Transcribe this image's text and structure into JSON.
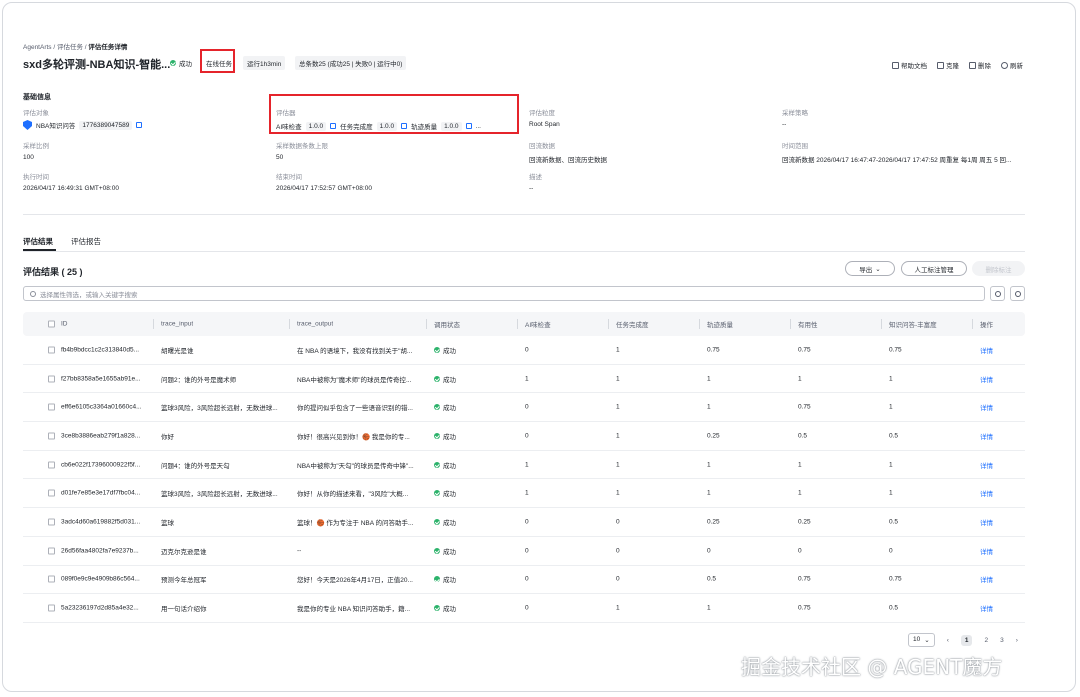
{
  "breadcrumb": {
    "root": "AgentArts",
    "sep1": "/",
    "mid": "评估任务",
    "sep2": "/",
    "current": "评估任务详情"
  },
  "header": {
    "title": "sxd多轮评测-NBA知识-智能...",
    "status": "成功",
    "task_type": "在线任务",
    "runtime": "运行1h3min",
    "summary": "总条数25 (成功25 | 失败0 | 运行中0)",
    "actions": {
      "help": "帮助文档",
      "clone": "克隆",
      "delete": "删除",
      "refresh": "刷新"
    }
  },
  "basic": {
    "section_title": "基础信息",
    "eval_target_label": "评估对象",
    "eval_target_name": "NBA知识问答",
    "eval_target_id": "1776389047589",
    "evaluator_label": "评估器",
    "evaluators": [
      {
        "name": "AI味检查",
        "version": "1.0.0"
      },
      {
        "name": "任务完成度",
        "version": "1.0.0"
      },
      {
        "name": "轨迹质量",
        "version": "1.0.0"
      }
    ],
    "evaluator_more": "...",
    "granularity_label": "评估粒度",
    "granularity": "Root Span",
    "sampling_strategy_label": "采样策略",
    "sampling_strategy": "--",
    "sampling_ratio_label": "采样比例",
    "sampling_ratio": "100",
    "sampling_limit_label": "采样数据条数上限",
    "sampling_limit": "50",
    "backflow_label": "回流数据",
    "backflow": "回流新数据、回流历史数据",
    "time_range_label": "时间范围",
    "time_range": "回流新数据 2026/04/17 16:47:47-2026/04/17 17:47:52 周重复 每1周 周五 5 回...",
    "exec_time_label": "执行时间",
    "exec_time": "2026/04/17 16:49:31 GMT+08:00",
    "end_time_label": "结束时间",
    "end_time": "2026/04/17 17:52:57 GMT+08:00",
    "desc_label": "描述",
    "desc": "--"
  },
  "tabs": {
    "results": "评估结果",
    "report": "评估报告"
  },
  "results": {
    "title": "评估结果 ( 25 )",
    "export": "导出",
    "manual": "人工标注管理",
    "disabled_btn": "删除标注",
    "search_placeholder": "选择属性筛选，或输入关键字搜索"
  },
  "table": {
    "headers": [
      "ID",
      "trace_input",
      "trace_output",
      "调用状态",
      "AI味检查",
      "任务完成度",
      "轨迹质量",
      "有用性",
      "知识问答-丰富度",
      "操作"
    ],
    "rows": [
      [
        "fb4b9bdcc1c2c313840d5...",
        "胡曙光是谁",
        "在 NBA 的语境下，我没有找到关于\"胡...",
        "成功",
        "0",
        "1",
        "0.75",
        "0.75",
        "0.75",
        "详情"
      ],
      [
        "f27bb8358a5e1655ab91e...",
        "问题2：谁的外号是魔术师",
        "NBA中被称为\"魔术师\"的球员是传奇控...",
        "成功",
        "1",
        "1",
        "1",
        "1",
        "1",
        "详情"
      ],
      [
        "eff6e6105c3364a01660c4...",
        "篮球3风险，3风险超长远射，无数进球...",
        "你的提问似乎包含了一些语音识别的错...",
        "成功",
        "0",
        "1",
        "1",
        "0.75",
        "1",
        "详情"
      ],
      [
        "3ce8b3886eab279f1a828...",
        "你好",
        "你好！很高兴见到你！🏀 我是你的专...",
        "成功",
        "0",
        "1",
        "0.25",
        "0.5",
        "0.5",
        "详情"
      ],
      [
        "cb6e022f17396000922f5f...",
        "问题4：谁的外号是天勾",
        "NBA中被称为\"天勾\"的球员是传奇中锋\"...",
        "成功",
        "1",
        "1",
        "1",
        "1",
        "1",
        "详情"
      ],
      [
        "d01fe7e85e3e17df7fbc04...",
        "篮球3风险，3风险超长远射，无数进球...",
        "你好！从你的描述来看，\"3风险\"大概...",
        "成功",
        "1",
        "1",
        "1",
        "1",
        "1",
        "详情"
      ],
      [
        "3adc4d60a619882f5d031...",
        "篮球",
        "篮球！🏀 作为专注于 NBA 的问答助手...",
        "成功",
        "0",
        "0",
        "0.25",
        "0.25",
        "0.5",
        "详情"
      ],
      [
        "26d56faa4802fa7e9237b...",
        "迈克尔克逊是谁",
        "--",
        "成功",
        "0",
        "0",
        "0",
        "0",
        "0",
        "详情"
      ],
      [
        "089f0e9c9e4909b86c564...",
        "预测今年总冠军",
        "您好！今天是2026年4月17日，正值20...",
        "成功",
        "0",
        "0",
        "0.5",
        "0.75",
        "0.75",
        "详情"
      ],
      [
        "5a23236197d2d85a4e32...",
        "用一句话介绍你",
        "我是你的专业 NBA 知识问答助手，籍...",
        "成功",
        "0",
        "1",
        "1",
        "0.75",
        "0.5",
        "详情"
      ]
    ]
  },
  "pager": {
    "size": "10",
    "pages": [
      "1",
      "2",
      "3"
    ],
    "prev": "‹",
    "next": "›"
  },
  "watermark": "掘金技术社区 @ AGENT魔方",
  "colors": {
    "accent": "#1e6fff",
    "success": "#2cb36b",
    "highlight_box": "#e5242b"
  }
}
